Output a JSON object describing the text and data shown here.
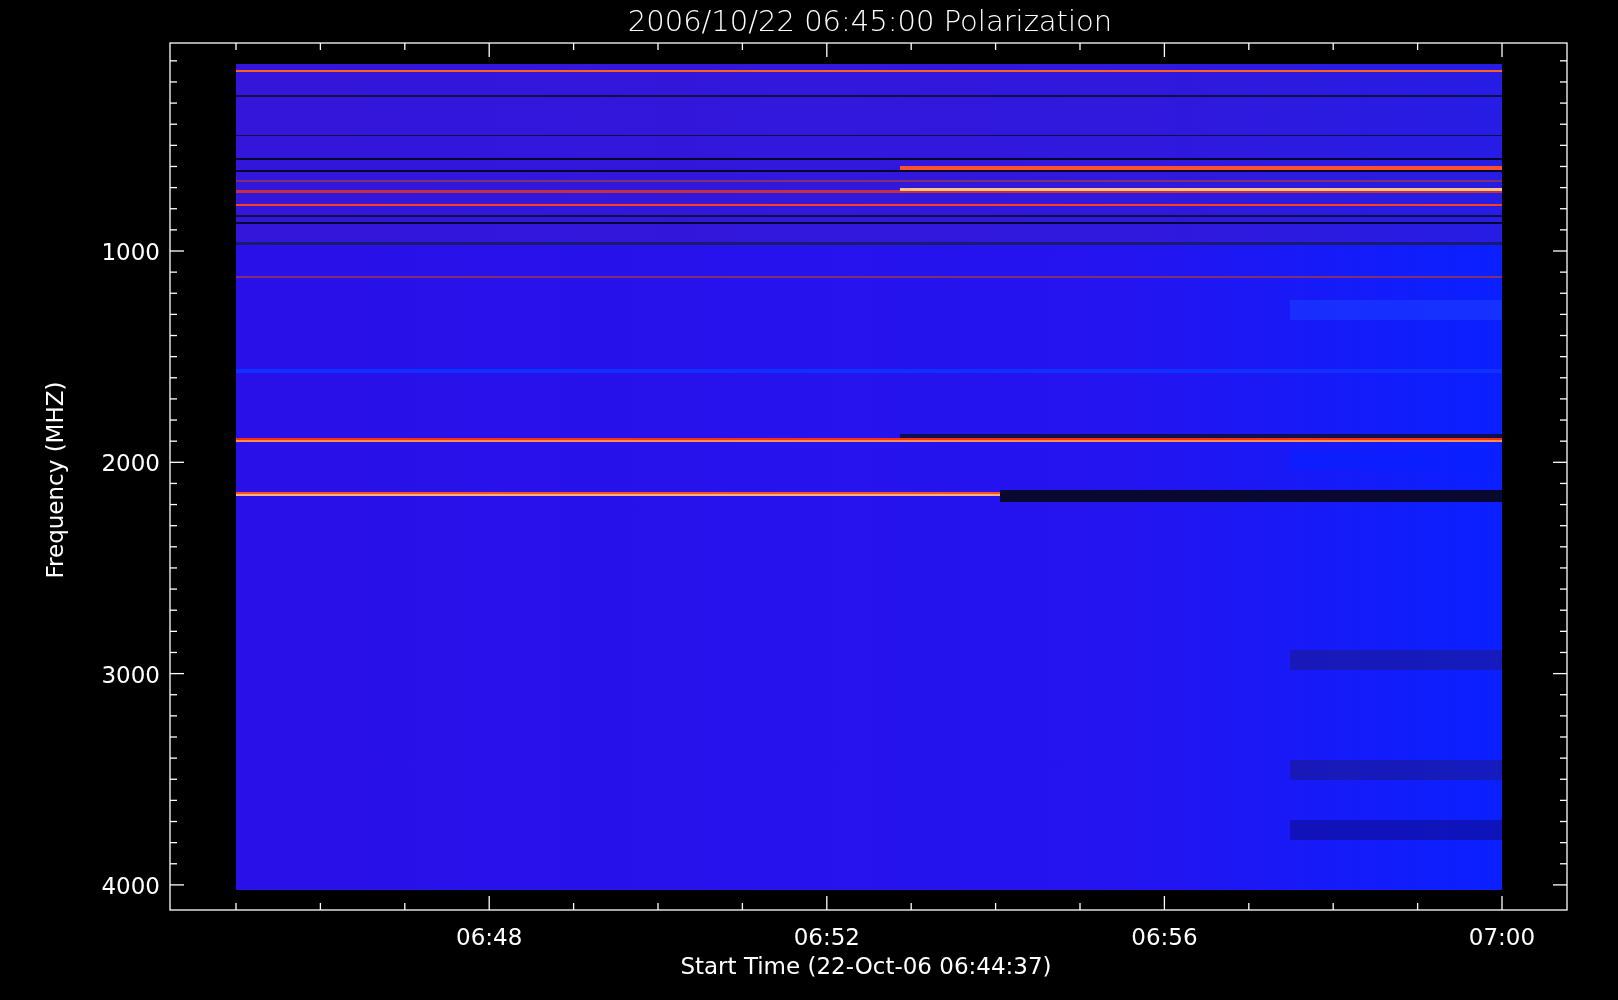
{
  "chart": {
    "title": "2006/10/22 06:45:00 Polarization",
    "xlabel": "Start Time (22-Oct-06 06:44:37)",
    "ylabel": "Frequency (MHZ)",
    "xtick_labels": [
      "06:48",
      "06:52",
      "06:56",
      "07:00"
    ],
    "ytick_labels": [
      "1000",
      "2000",
      "3000",
      "4000"
    ]
  }
}
